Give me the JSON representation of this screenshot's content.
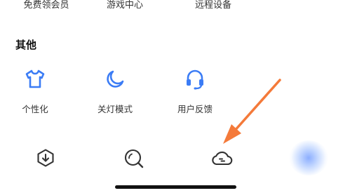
{
  "top_row": {
    "items": [
      {
        "label": "免费领会员"
      },
      {
        "label": "游戏中心"
      },
      {
        "label": "远程设备"
      }
    ]
  },
  "section": {
    "title": "其他",
    "items": [
      {
        "label": "个性化",
        "icon": "shirt-icon"
      },
      {
        "label": "关灯模式",
        "icon": "moon-icon"
      },
      {
        "label": "用户反馈",
        "icon": "headset-icon"
      }
    ]
  },
  "tabbar": {
    "items": [
      {
        "icon": "download-icon"
      },
      {
        "icon": "search-icon"
      },
      {
        "icon": "cloud-icon"
      }
    ]
  },
  "colors": {
    "accent_blue": "#3b7cf5",
    "arrow_orange": "#f47a3a",
    "text": "#333333"
  }
}
